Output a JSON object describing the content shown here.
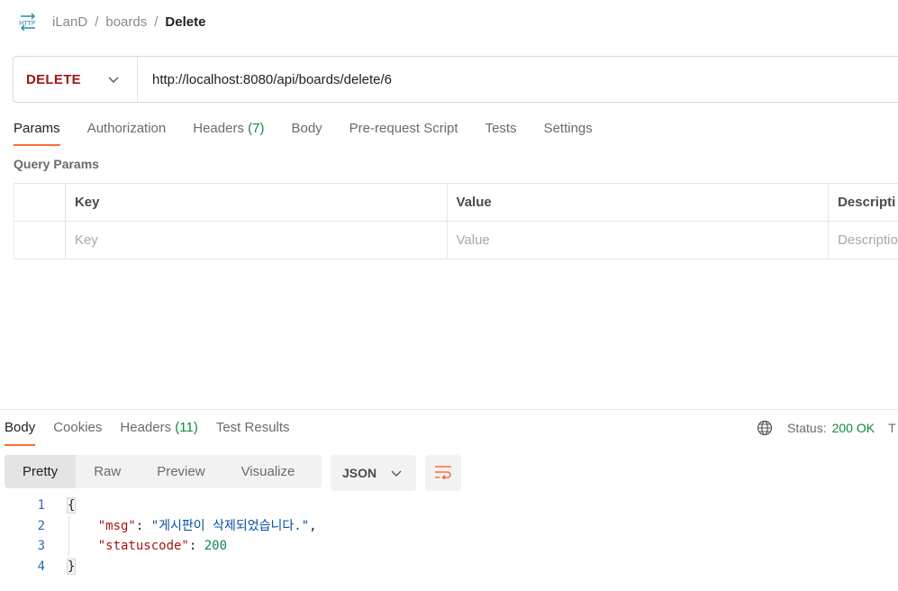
{
  "breadcrumb": {
    "icon": "http-icon",
    "items": [
      "iLanD",
      "boards"
    ],
    "separator": "/",
    "current": "Delete"
  },
  "request": {
    "method": "DELETE",
    "url": "http://localhost:8080/api/boards/delete/6"
  },
  "request_tabs": [
    {
      "label": "Params",
      "count": "",
      "active": true
    },
    {
      "label": "Authorization",
      "count": ""
    },
    {
      "label": "Headers",
      "count": "(7)"
    },
    {
      "label": "Body",
      "count": ""
    },
    {
      "label": "Pre-request Script",
      "count": ""
    },
    {
      "label": "Tests",
      "count": ""
    },
    {
      "label": "Settings",
      "count": ""
    }
  ],
  "query_params": {
    "title": "Query Params",
    "headers": [
      "Key",
      "Value",
      "Descripti"
    ],
    "placeholders": [
      "Key",
      "Value",
      "Descriptio"
    ]
  },
  "response_tabs": [
    {
      "label": "Body",
      "count": "",
      "active": true
    },
    {
      "label": "Cookies",
      "count": ""
    },
    {
      "label": "Headers",
      "count": "(11)"
    },
    {
      "label": "Test Results",
      "count": ""
    }
  ],
  "status": {
    "label": "Status:",
    "value": "200 OK",
    "next_cut": "T"
  },
  "view_modes": [
    "Pretty",
    "Raw",
    "Preview",
    "Visualize"
  ],
  "format": "JSON",
  "code": {
    "line_numbers": [
      "1",
      "2",
      "3",
      "4"
    ],
    "open_brace": "{",
    "close_brace": "}",
    "msg_key": "\"msg\"",
    "msg_value": "\"게시판이 삭제되었습니다.\"",
    "statuscode_key": "\"statuscode\"",
    "statuscode_value": "200"
  },
  "colors": {
    "accent": "#ff6c37",
    "method": "#a31515",
    "status_ok": "#0f8a3c",
    "json_key": "#a31515",
    "json_string": "#0451a5",
    "json_number": "#098658"
  }
}
